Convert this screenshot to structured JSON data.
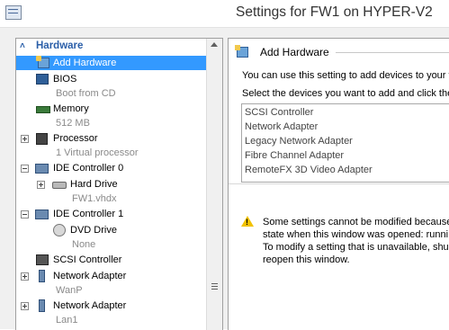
{
  "window": {
    "title": "Settings for FW1 on HYPER-V2"
  },
  "tree": {
    "section_label": "Hardware",
    "items": [
      {
        "label": "Add Hardware"
      },
      {
        "label": "BIOS",
        "sub": "Boot from CD"
      },
      {
        "label": "Memory",
        "sub": "512 MB"
      },
      {
        "label": "Processor",
        "sub": "1 Virtual processor"
      },
      {
        "label": "IDE Controller 0"
      },
      {
        "label": "Hard Drive",
        "sub": "FW1.vhdx"
      },
      {
        "label": "IDE Controller 1"
      },
      {
        "label": "DVD Drive",
        "sub": "None"
      },
      {
        "label": "SCSI Controller"
      },
      {
        "label": "Network Adapter",
        "sub": "WanP"
      },
      {
        "label": "Network Adapter",
        "sub": "Lan1"
      }
    ]
  },
  "panel": {
    "title": "Add Hardware",
    "intro": "You can use this setting to add devices to your v",
    "select_prompt": "Select the devices you want to add and click the",
    "devices": [
      "SCSI Controller",
      "Network Adapter",
      "Legacy Network Adapter",
      "Fibre Channel Adapter",
      "RemoteFX 3D Video Adapter"
    ],
    "warning_lines": [
      "Some settings cannot be modified because",
      "state when this window was opened: runni",
      "To modify a setting that is unavailable, shu",
      "reopen this window."
    ]
  }
}
